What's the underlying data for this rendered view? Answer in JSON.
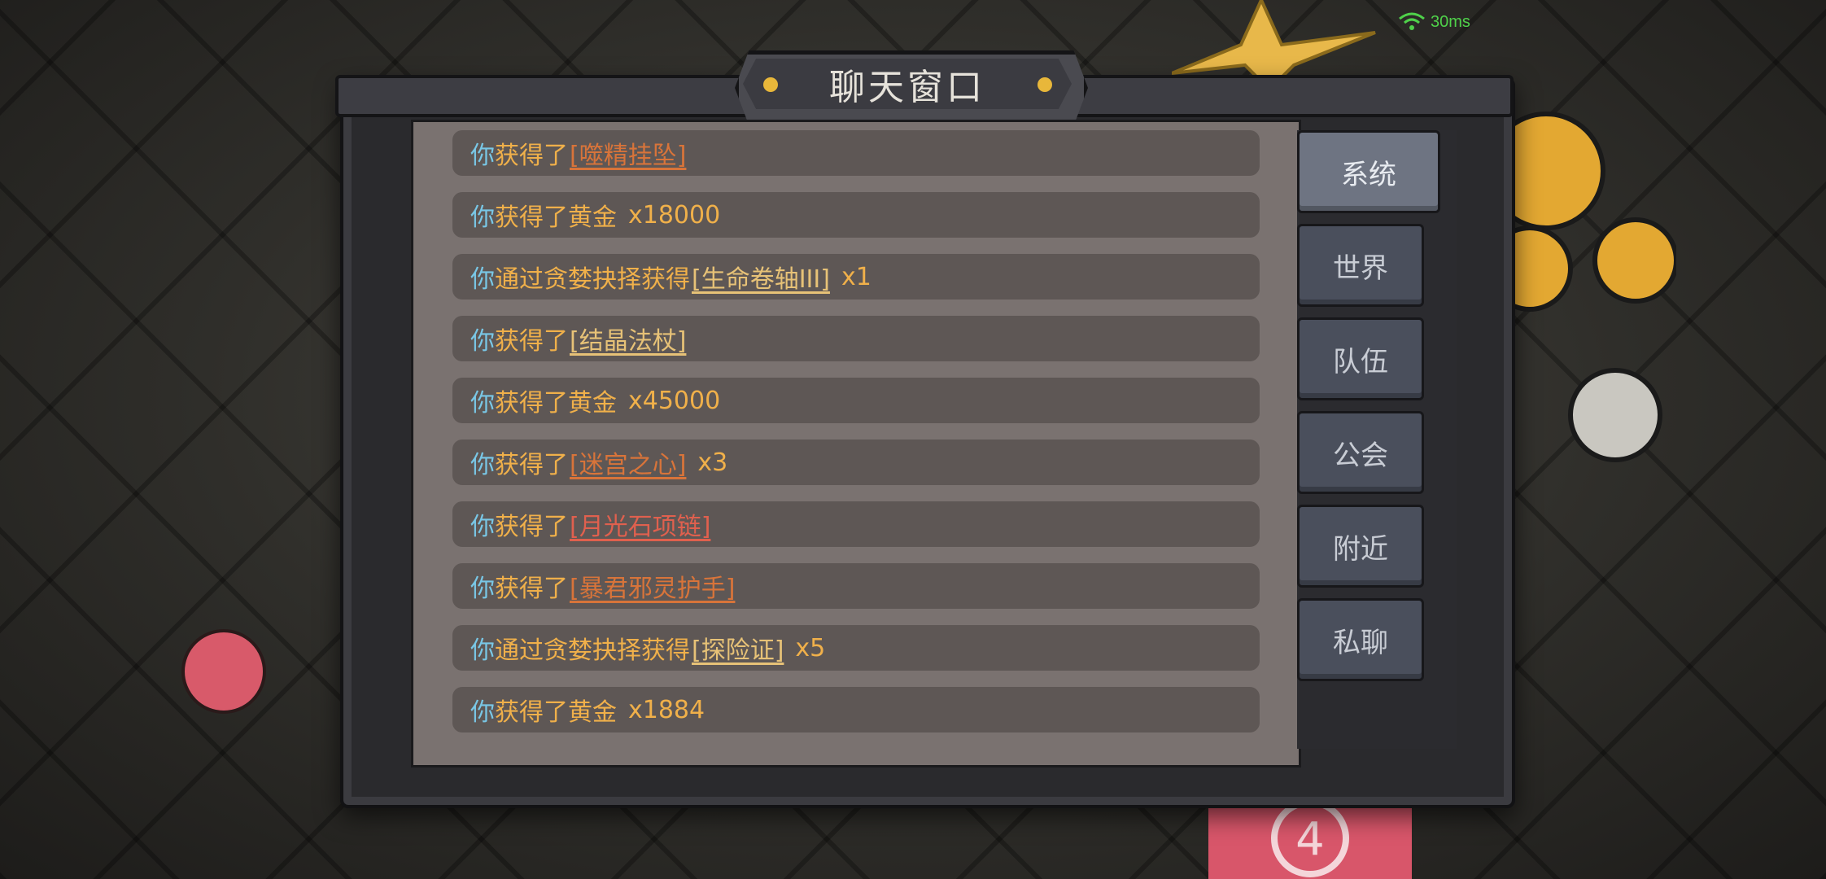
{
  "status": {
    "ping": "30ms"
  },
  "window": {
    "title": "聊天窗口"
  },
  "messages": [
    {
      "you": "你",
      "text": "获得了",
      "item": "[噬精挂坠]",
      "item_color": "#d8743a",
      "amount": ""
    },
    {
      "you": "你",
      "text": "获得了黄金",
      "item": "",
      "item_color": "",
      "amount": "x18000"
    },
    {
      "you": "你",
      "text": "通过贪婪抉择获得",
      "item": "[生命卷轴III]",
      "item_color": "#e7c277",
      "amount": "x1"
    },
    {
      "you": "你",
      "text": "获得了",
      "item": "[结晶法杖]",
      "item_color": "#e7c277",
      "amount": ""
    },
    {
      "you": "你",
      "text": "获得了黄金",
      "item": "",
      "item_color": "",
      "amount": "x45000"
    },
    {
      "you": "你",
      "text": "获得了",
      "item": "[迷宫之心]",
      "item_color": "#d8743a",
      "amount": "x3"
    },
    {
      "you": "你",
      "text": "获得了",
      "item": "[月光石项链]",
      "item_color": "#e0604e",
      "amount": ""
    },
    {
      "you": "你",
      "text": "获得了",
      "item": "[暴君邪灵护手]",
      "item_color": "#d8743a",
      "amount": ""
    },
    {
      "you": "你",
      "text": "通过贪婪抉择获得",
      "item": "[探险证]",
      "item_color": "#e7c277",
      "amount": "x5"
    },
    {
      "you": "你",
      "text": "获得了黄金",
      "item": "",
      "item_color": "",
      "amount": "x1884"
    }
  ],
  "tabs": [
    {
      "label": "系统",
      "active": true
    },
    {
      "label": "世界",
      "active": false
    },
    {
      "label": "队伍",
      "active": false
    },
    {
      "label": "公会",
      "active": false
    },
    {
      "label": "附近",
      "active": false
    },
    {
      "label": "私聊",
      "active": false
    }
  ],
  "colors": {
    "you": "#79c7e6",
    "text": "#f0b04a",
    "accent_gold": "#e8b73a"
  },
  "decorations": {
    "round_counter": "4"
  }
}
